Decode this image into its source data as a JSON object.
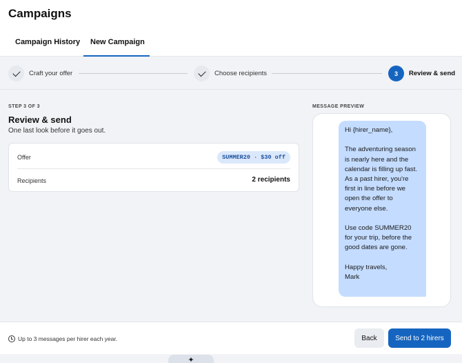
{
  "page": {
    "title": "Campaigns"
  },
  "tabs": [
    {
      "label": "Campaign History",
      "active": false
    },
    {
      "label": "New Campaign",
      "active": true
    }
  ],
  "stepper": {
    "steps": [
      {
        "label": "Craft your offer",
        "status": "done",
        "icon": "check-icon"
      },
      {
        "label": "Choose recipients",
        "status": "done",
        "icon": "check-icon"
      },
      {
        "label": "Review & send",
        "status": "active",
        "number": "3"
      }
    ]
  },
  "review": {
    "step_meta": "STEP 3 OF 3",
    "title": "Review & send",
    "subtitle": "One last look before it goes out.",
    "offer_label": "Offer",
    "offer_value": "SUMMER20 · $30 off",
    "recipients_label": "Recipients",
    "recipients_value": "2 recipients"
  },
  "preview": {
    "label": "MESSAGE PREVIEW",
    "message": "Hi {hirer_name},\n\nThe adventuring season is nearly here and the calendar is filling up fast. As a past hirer, you're first in line before we open the offer to everyone else.\n\nUse code SUMMER20 for your trip, before the good dates are gone.\n\nHappy travels,\nMark"
  },
  "footer": {
    "note_icon": "clock-icon",
    "note": "Up to 3 messages per hirer each year.",
    "back_label": "Back",
    "send_label": "Send to 2 hirers"
  },
  "dock": {
    "icon": "sparkle-icon",
    "glyph": "✦"
  },
  "colors": {
    "accent": "#1565c0",
    "bubble": "#c4dcff",
    "badge_bg": "#dbe8fb"
  }
}
